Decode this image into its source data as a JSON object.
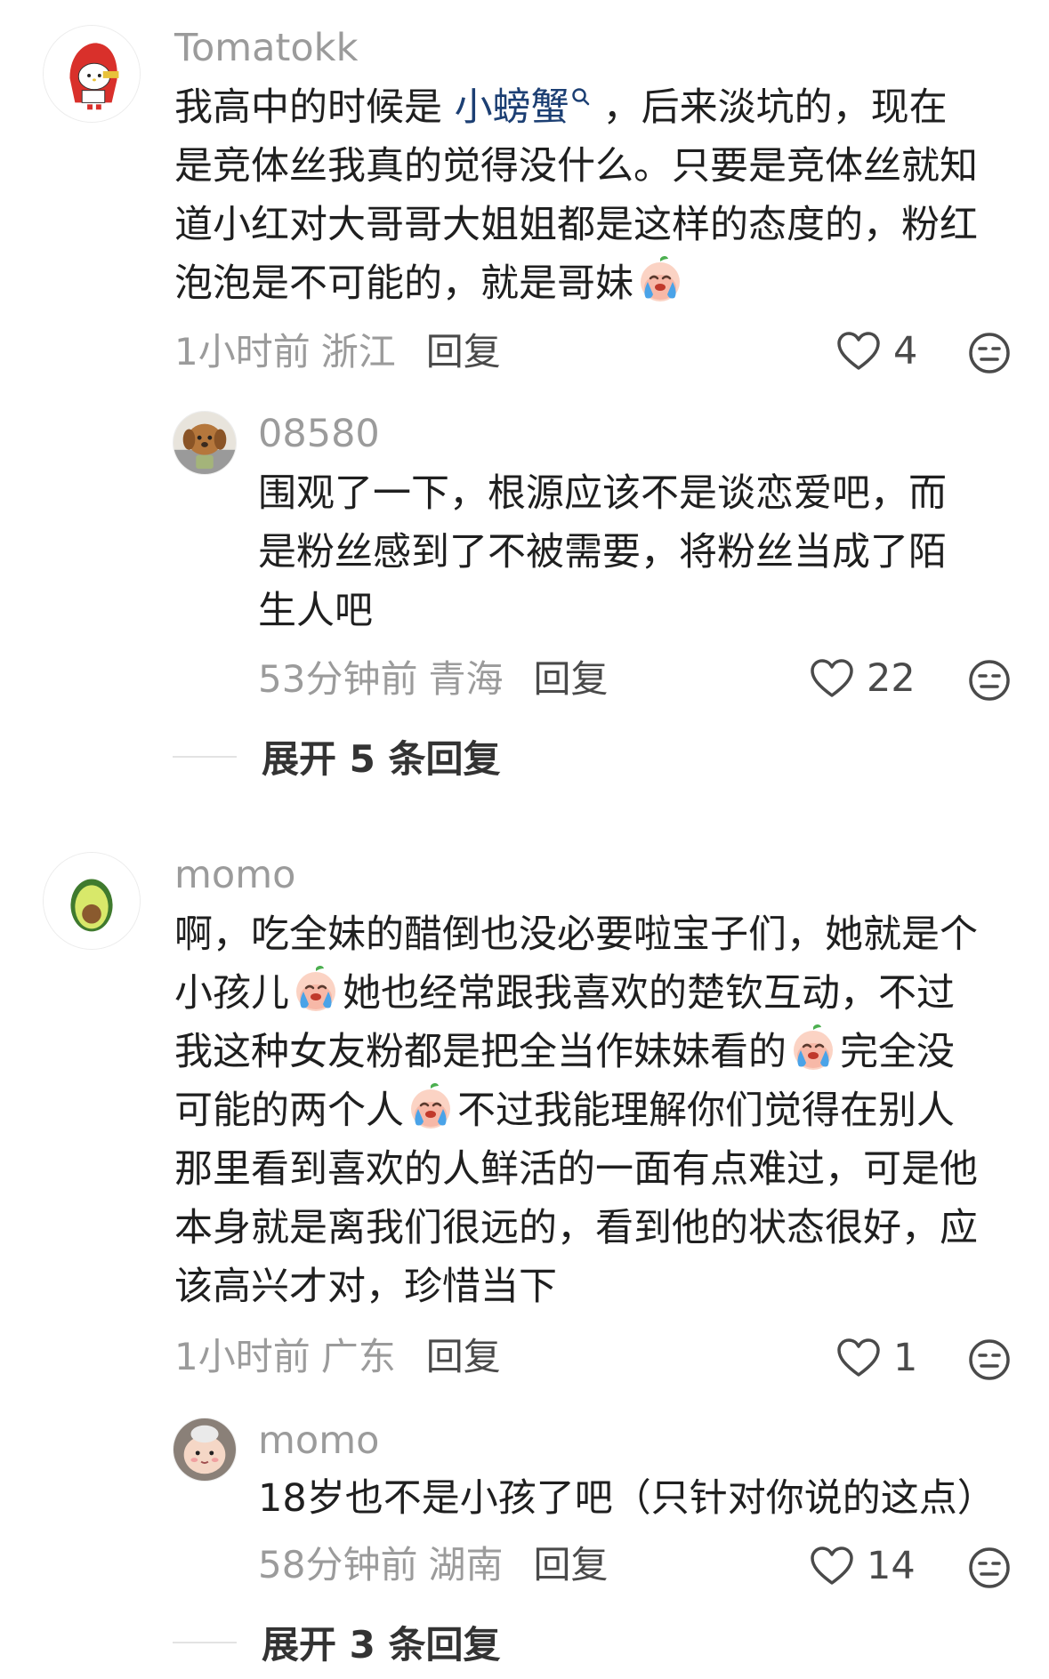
{
  "comments": [
    {
      "username": "Tomatokk",
      "avatar": "hello-kitty-red-hood-avatar",
      "lines": [
        {
          "a": "我高中的时候是 ",
          "link": "小螃蟹",
          "b": "，后来淡坑的，现在"
        },
        "是竞体丝我真的觉得没什么。只要是竞体丝就知",
        "道小红对大哥哥大姐姐都是这样的态度的，粉红",
        "泡泡是不可能的，就是哥妹"
      ],
      "time": "1小时前",
      "location": "浙江",
      "reply_label": "回复",
      "likes": "4",
      "replies": [
        {
          "username": "08580",
          "avatar": "puppy-avatar",
          "lines": [
            "围观了一下，根源应该不是谈恋爱吧，而",
            "是粉丝感到了不被需要，将粉丝当成了陌",
            "生人吧"
          ],
          "time": "53分钟前",
          "location": "青海",
          "reply_label": "回复",
          "likes": "22"
        }
      ],
      "expand_label": "展开 5 条回复"
    },
    {
      "username": "momo",
      "avatar": "avocado-avatar",
      "lines": [
        "啊，吃全妹的醋倒也没必要啦宝子们，她就是个",
        {
          "a": "小孩儿",
          "b": "她也经常跟我喜欢的楚钦互动，不过"
        },
        {
          "a": "我这种女友粉都是把全当作妹妹看的",
          "b": "完全没"
        },
        {
          "a": "可能的两个人",
          "b": "不过我能理解你们觉得在别人"
        },
        "那里看到喜欢的人鲜活的一面有点难过，可是他",
        "本身就是离我们很远的，看到他的状态很好，应",
        "该高兴才对，珍惜当下"
      ],
      "time": "1小时前",
      "location": "广东",
      "reply_label": "回复",
      "likes": "1",
      "replies": [
        {
          "username": "momo",
          "avatar": "plush-toy-avatar",
          "lines": [
            "18岁也不是小孩了吧（只针对你说的这点）"
          ],
          "time": "58分钟前",
          "location": "湖南",
          "reply_label": "回复",
          "likes": "14"
        }
      ],
      "expand_label": "展开 3 条回复"
    }
  ],
  "icons": {
    "emoji": "crying-face-emoji",
    "like": "heart-outline-icon",
    "dislike": "meh-face-icon",
    "search": "search-icon"
  },
  "colors": {
    "link": "#1c3f73",
    "muted": "#9b9b9b",
    "text": "#1f1f1f"
  }
}
